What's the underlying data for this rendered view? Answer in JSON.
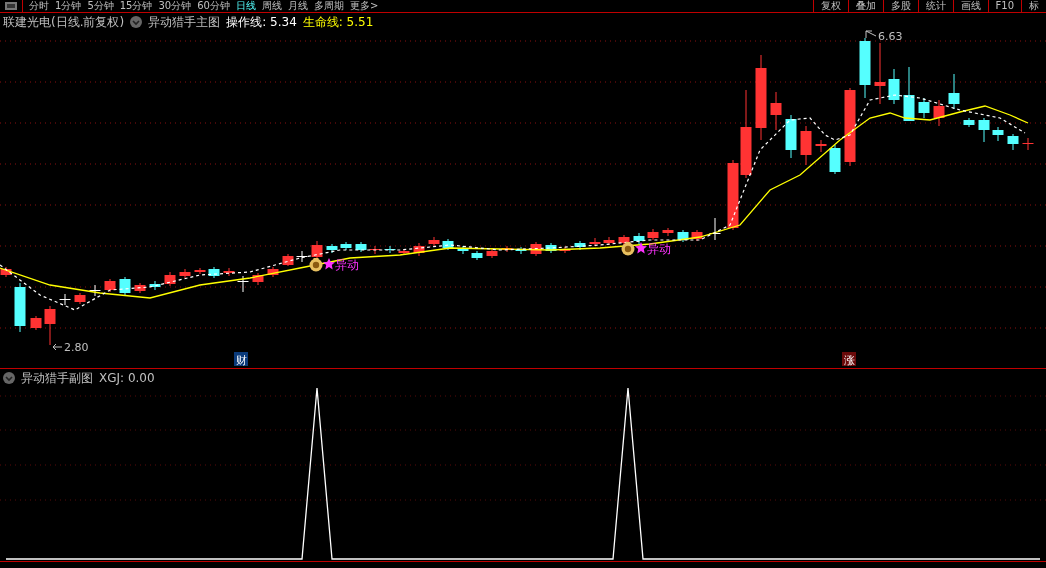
{
  "period_tabs": [
    {
      "label": "分时",
      "selected": false
    },
    {
      "label": "1分钟",
      "selected": false
    },
    {
      "label": "5分钟",
      "selected": false
    },
    {
      "label": "15分钟",
      "selected": false
    },
    {
      "label": "30分钟",
      "selected": false
    },
    {
      "label": "60分钟",
      "selected": false
    },
    {
      "label": "日线",
      "selected": true
    },
    {
      "label": "周线",
      "selected": false
    },
    {
      "label": "月线",
      "selected": false
    },
    {
      "label": "多周期",
      "selected": false
    },
    {
      "label": "更多>",
      "selected": false
    }
  ],
  "tool_buttons": [
    "复权",
    "叠加",
    "多股",
    "统计",
    "画线",
    "F10",
    "标"
  ],
  "main_chart": {
    "stock": "联建光电(日线.前复权)",
    "indicator": "异动猎手主图",
    "readings": [
      {
        "text": "操作线: 5.34",
        "color": "#ffffff"
      },
      {
        "text": "生命线: 5.51",
        "color": "#ffff00"
      }
    ],
    "low_label": "2.80",
    "high_label": "6.63",
    "signals": [
      {
        "text": "异动"
      },
      {
        "text": "异动"
      }
    ],
    "event_tags": [
      {
        "text": "财",
        "kind": "finance"
      },
      {
        "text": "涨",
        "kind": "rise"
      }
    ]
  },
  "sub_chart": {
    "indicator": "异动猎手副图",
    "reading": "XGJ: 0.00"
  }
}
